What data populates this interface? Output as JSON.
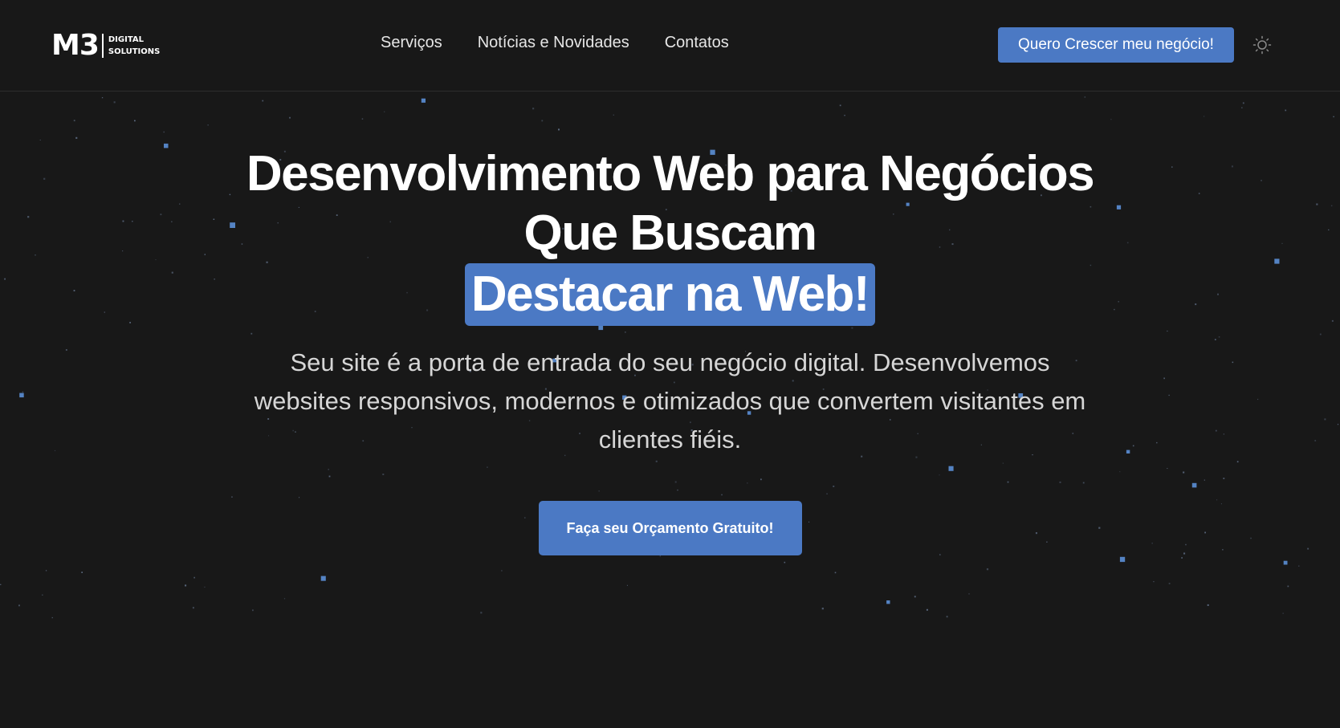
{
  "header": {
    "logo": {
      "mark": "M3",
      "line1": "DIGITAL",
      "line2": "SOLUTIONS"
    },
    "nav": [
      {
        "label": "Serviços"
      },
      {
        "label": "Notícias e Novidades"
      },
      {
        "label": "Contatos"
      }
    ],
    "cta_label": "Quero Crescer meu negócio!",
    "theme_toggle_icon": "sun-icon"
  },
  "hero": {
    "title_line1": "Desenvolvimento Web para Negócios",
    "title_line2": "Que Buscam",
    "title_highlight": "Destacar na Web!",
    "subtitle": "Seu site é a porta de entrada do seu negócio digital. Desenvolvemos websites responsivos, modernos e otimizados que convertem visitantes em clientes fiéis.",
    "cta_label": "Faça seu Orçamento Gratuito!"
  },
  "colors": {
    "background": "#181818",
    "accent": "#4b79c4",
    "text": "#ffffff",
    "muted_text": "#d6d6d6",
    "star": "#5b8fd6"
  }
}
